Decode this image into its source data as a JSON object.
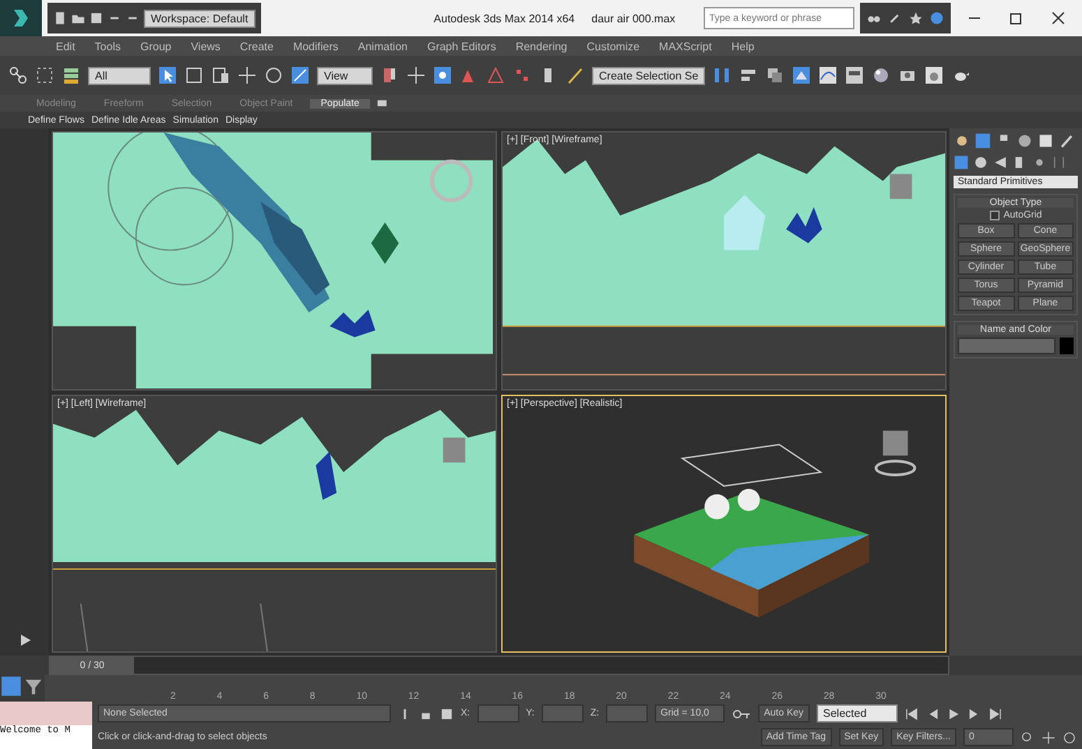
{
  "title_bar": {
    "workspace": "Workspace: Default",
    "title": "Autodesk 3ds Max 2014 x64",
    "file": "daur air 000.max",
    "search": {
      "placeholder": "Type a keyword or phrase"
    }
  },
  "menus": [
    "Edit",
    "Tools",
    "Group",
    "Views",
    "Create",
    "Modifiers",
    "Animation",
    "Graph Editors",
    "Rendering",
    "Customize",
    "MAXScript",
    "Help"
  ],
  "toolbar": {
    "selection_filter": "All",
    "reference_coordinate": "View",
    "named_selection": "Create Selection Se"
  },
  "ribbon_tabs": [
    {
      "label": "Modeling",
      "selected": false
    },
    {
      "label": "Freeform",
      "selected": false
    },
    {
      "label": "Selection",
      "selected": false
    },
    {
      "label": "Object Paint",
      "selected": false
    },
    {
      "label": "Populate",
      "selected": true
    }
  ],
  "ribbon_panel": [
    "Define Flows",
    "Define Idle Areas",
    "Simulation",
    "Display"
  ],
  "viewports": [
    {
      "kind": "top",
      "active": false
    },
    {
      "kind": "front",
      "label": "[+] [Front] [Wireframe]",
      "active": false
    },
    {
      "kind": "left",
      "label": "[+] [Left] [Wireframe]",
      "active": false
    },
    {
      "kind": "perspective",
      "label": "[+] [Perspective] [Realistic]",
      "active": true
    }
  ],
  "command_panel": {
    "category": "Standard Primitives",
    "object_type": {
      "title": "Object Type",
      "autogrid": {
        "label": "AutoGrid",
        "checked": false
      },
      "buttons": [
        "Box",
        "Cone",
        "Sphere",
        "GeoSphere",
        "Cylinder",
        "Tube",
        "Torus",
        "Pyramid",
        "Teapot",
        "Plane"
      ]
    },
    "name_and_color": {
      "title": "Name and Color"
    }
  },
  "time_slider": {
    "reading": "0 / 30",
    "level": 0
  },
  "track_ticks": [
    "2",
    "4",
    "6",
    "8",
    "10",
    "12",
    "14",
    "16",
    "18",
    "20",
    "22",
    "24",
    "26",
    "28",
    "30"
  ],
  "status": {
    "maxscript": "Welcome to M",
    "selection": "None Selected",
    "prompt": "Click or click-and-drag to select objects",
    "x_label": "X:",
    "y_label": "Y:",
    "z_label": "Z:",
    "grid": "Grid = 10,0",
    "time_tag": "Add Time Tag",
    "auto_key": "Auto Key",
    "key_mode": "Selected",
    "set_key": "Set Key",
    "key_filters": "Key Filters...",
    "frame": "0"
  }
}
